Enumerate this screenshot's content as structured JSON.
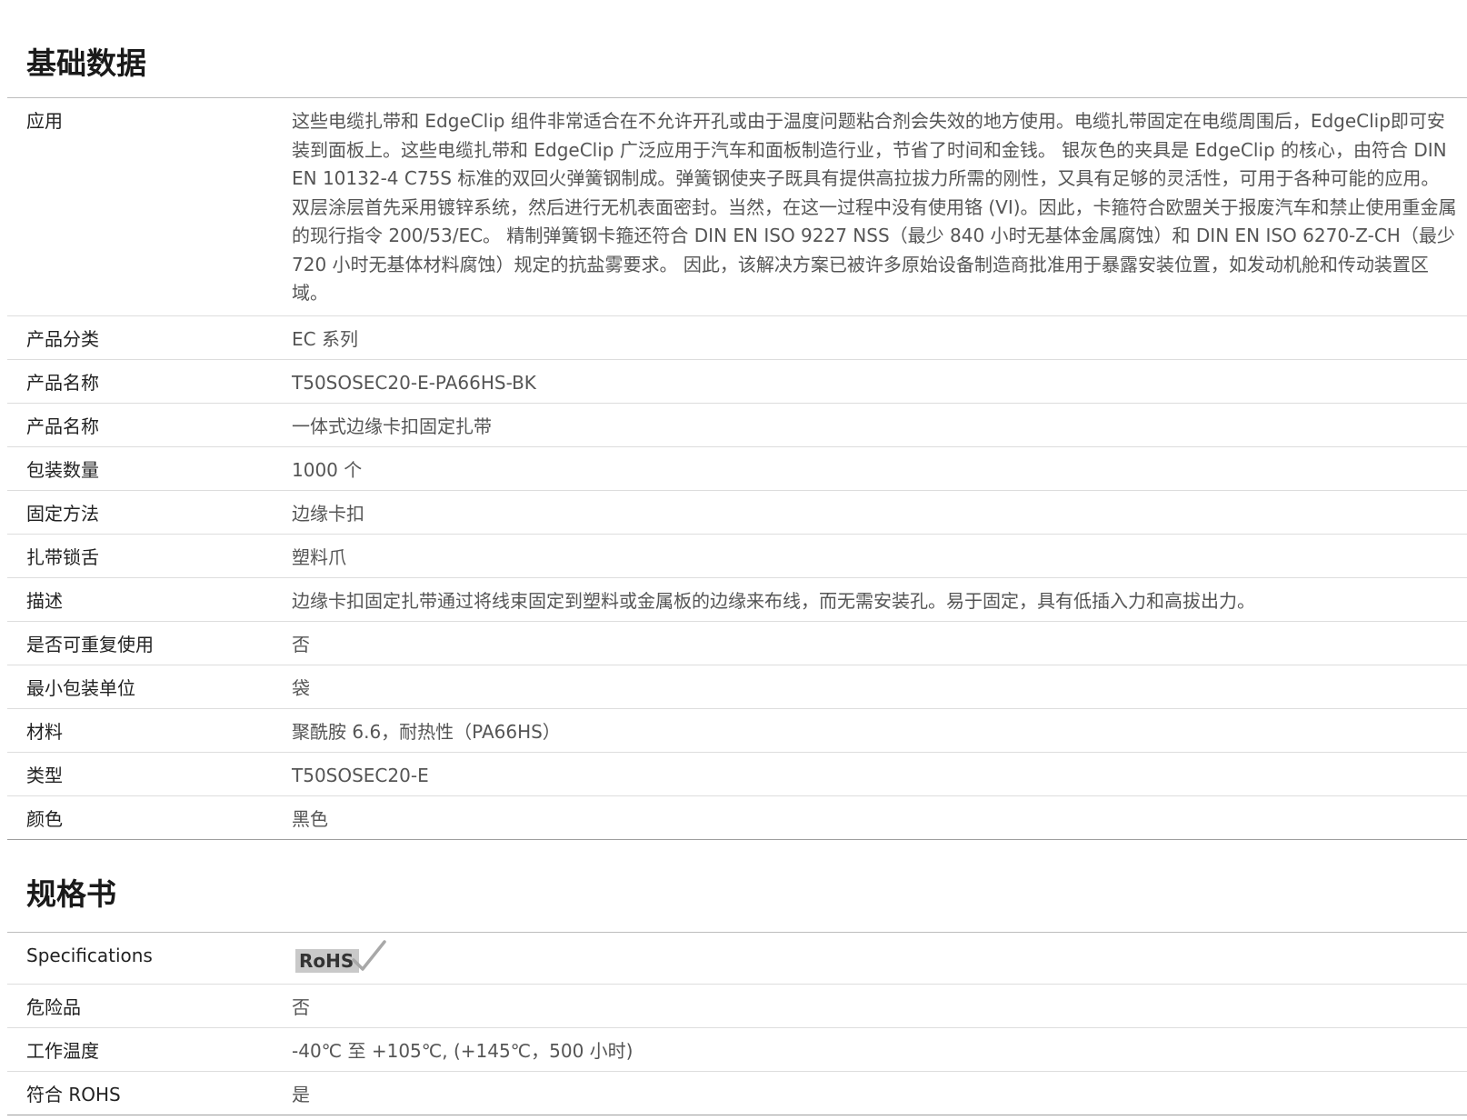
{
  "sections": [
    {
      "title": "基础数据",
      "rows": [
        {
          "label": "应用",
          "value": "这些电缆扎带和 EdgeClip 组件非常适合在不允许开孔或由于温度问题粘合剂会失效的地方使用。电缆扎带固定在电缆周围后，EdgeClip即可安装到面板上。这些电缆扎带和 EdgeClip 广泛应用于汽车和面板制造行业，节省了时间和金钱。 银灰色的夹具是 EdgeClip 的核心，由符合 DIN EN 10132-4 C75S 标准的双回火弹簧钢制成。弹簧钢使夹子既具有提供高拉拔力所需的刚性，又具有足够的灵活性，可用于各种可能的应用。 双层涂层首先采用镀锌系统，然后进行无机表面密封。当然，在这一过程中没有使用铬 (VI)。因此，卡箍符合欧盟关于报废汽车和禁止使用重金属的现行指令 200/53/EC。 精制弹簧钢卡箍还符合 DIN EN ISO 9227 NSS（最少 840 小时无基体金属腐蚀）和 DIN EN ISO 6270-Z-CH（最少 720 小时无基体材料腐蚀）规定的抗盐雾要求。 因此，该解决方案已被许多原始设备制造商批准用于暴露安装位置，如发动机舱和传动装置区域。"
        },
        {
          "label": "产品分类",
          "value": "EC 系列"
        },
        {
          "label": "产品名称",
          "value": "T50SOSEC20-E-PA66HS-BK"
        },
        {
          "label": "产品名称",
          "value": "一体式边缘卡扣固定扎带"
        },
        {
          "label": "包装数量",
          "value": "1000 个"
        },
        {
          "label": "固定方法",
          "value": "边缘卡扣"
        },
        {
          "label": "扎带锁舌",
          "value": "塑料爪"
        },
        {
          "label": "描述",
          "value": "边缘卡扣固定扎带通过将线束固定到塑料或金属板的边缘来布线，而无需安装孔。易于固定，具有低插入力和高拔出力。"
        },
        {
          "label": "是否可重复使用",
          "value": "否"
        },
        {
          "label": "最小包装单位",
          "value": "袋"
        },
        {
          "label": "材料",
          "value": "聚酰胺 6.6，耐热性（PA66HS）"
        },
        {
          "label": "类型",
          "value": "T50SOSEC20-E"
        },
        {
          "label": "颜色",
          "value": "黑色"
        }
      ]
    },
    {
      "title": "规格书",
      "rows": [
        {
          "label": "Specifications",
          "value": "",
          "badge": "RoHS"
        },
        {
          "label": "危险品",
          "value": "否"
        },
        {
          "label": "工作温度",
          "value": "-40℃ 至 +105℃, (+145℃，500 小时)"
        },
        {
          "label": "符合 ROHS",
          "value": "是"
        }
      ]
    }
  ]
}
